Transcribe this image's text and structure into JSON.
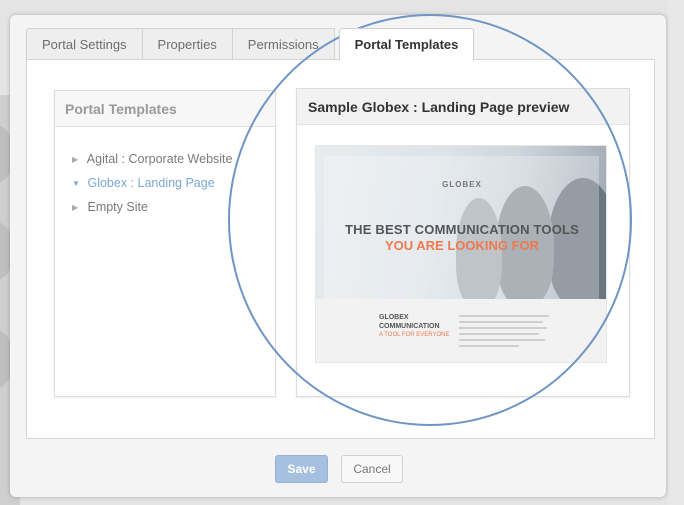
{
  "tabs": [
    "Portal Settings",
    "Properties",
    "Permissions",
    "Portal Templates"
  ],
  "active_tab": "Portal Templates",
  "left_panel": {
    "title": "Portal Templates",
    "items": [
      {
        "label": "Agital : Corporate Website",
        "arrow": "▶"
      },
      {
        "label": "Globex : Landing Page",
        "arrow": "▼"
      },
      {
        "label": "Empty Site",
        "arrow": "▶"
      }
    ]
  },
  "right_panel": {
    "title": "Sample Globex : Landing Page preview",
    "preview": {
      "brand": "GLOBEX",
      "headline": "THE BEST COMMUNICATION TOOLS",
      "subheadline": "YOU ARE LOOKING FOR",
      "section_name": "GLOBEX COMMUNICATION",
      "section_tag": "A TOOL FOR EVERYONE"
    }
  },
  "buttons": {
    "save": "Save",
    "cancel": "Cancel"
  },
  "colors": {
    "accent": "#6f95c4",
    "selected_text": "#7da7d8",
    "headline_orange": "#f07a4e",
    "save_button": "#a6c0df"
  },
  "icons": {
    "collapsed": "caret-right-icon",
    "expanded": "caret-down-icon"
  }
}
